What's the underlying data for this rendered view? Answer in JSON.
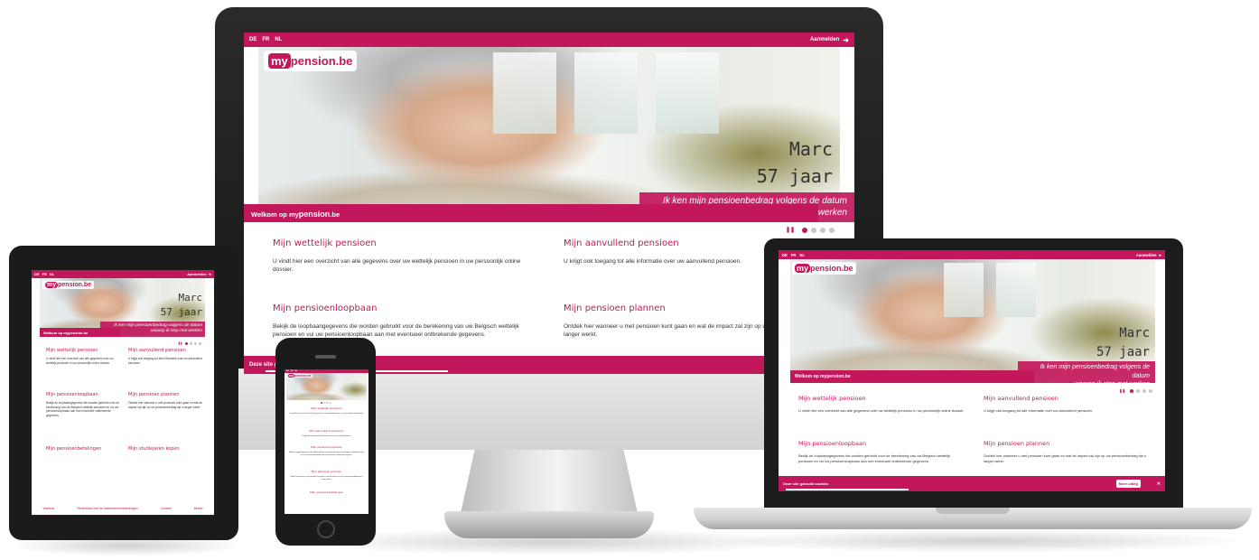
{
  "site": {
    "languages": [
      "DE",
      "FR",
      "NL"
    ],
    "login_label": "Aanmelden",
    "logo_my": "my",
    "logo_rest": "pension.be",
    "person_name": "Marc",
    "person_age": "57 jaar",
    "tagline_line1": "Ik ken mijn pensioenbedrag volgens de datum",
    "tagline_line2": "waarop ik stop met werken",
    "welcome_prefix": "Welkom op my",
    "welcome_brand": "pension",
    "welcome_suffix": ".be",
    "pause_symbol": "❚❚",
    "cookie_text": "Deze site gebruikt cookies",
    "more_info": "Meer uitleg",
    "close_symbol": "✕",
    "cards": [
      {
        "title": "Mijn wettelijk pensioen",
        "text": "U vindt hier een overzicht van alle gegevens over uw wettelijk pensioen in uw persoonlijk online dossier."
      },
      {
        "title": "Mijn aanvullend pensioen",
        "text": "U krijgt ook toegang tot alle informatie over uw aanvullend pensioen."
      },
      {
        "title": "Mijn pensioenloopbaan",
        "text": "Bekijk de loopbaangegevens die worden gebruikt voor de berekening van uw Belgisch wettelijk pensioen en vul uw pensioenloopbaan aan met eventueel ontbrekende gegevens."
      },
      {
        "title": "Mijn pensioen plannen",
        "text": "Ontdek hier wanneer u met pensioen kunt gaan en wat de impact zal zijn op uw pensioenbedrag als u langer werkt."
      },
      {
        "title": "Mijn pensioenbetalingen",
        "text": ""
      },
      {
        "title": "Mijn studiejaren kopen",
        "text": ""
      }
    ],
    "footer_links": [
      "Webinar",
      "Rekenblad met de basisreferentiebedragen",
      "Contact",
      "Beleid"
    ]
  }
}
